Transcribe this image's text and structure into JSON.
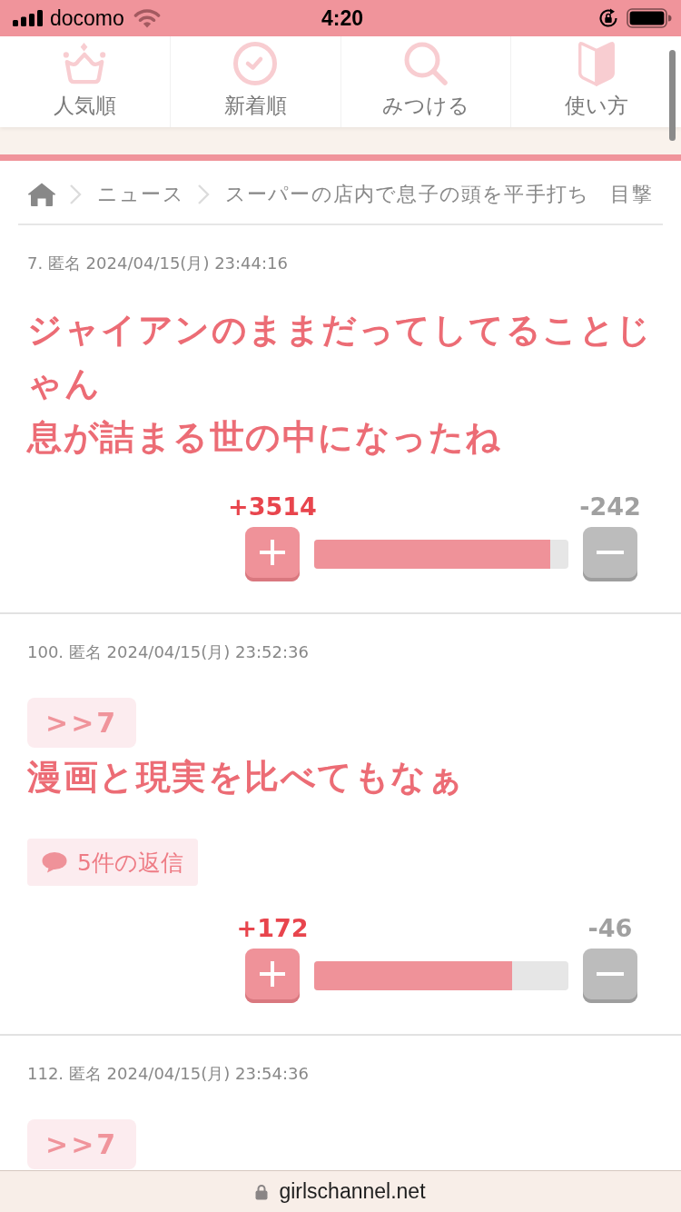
{
  "status_bar": {
    "carrier": "docomo",
    "time": "4:20"
  },
  "nav_tabs": [
    {
      "label": "人気順"
    },
    {
      "label": "新着順"
    },
    {
      "label": "みつける"
    },
    {
      "label": "使い方"
    }
  ],
  "breadcrumb": [
    {
      "label": "ニュース"
    },
    {
      "label": "スーパーの店内で息子の頭を平手打ち　目撃"
    }
  ],
  "comments": [
    {
      "header": "7. 匿名 2024/04/15(月) 23:44:16",
      "body": [
        "ジャイアンのままだってしてることじゃん",
        "息が詰まる世の中になったね"
      ],
      "votes": {
        "plus": "+3514",
        "minus": "-242",
        "level": 0.93
      }
    },
    {
      "header": "100. 匿名 2024/04/15(月) 23:52:36",
      "anchor": ">>7",
      "body": [
        "漫画と現実を比べてもなぁ"
      ],
      "replies": "5件の返信",
      "votes": {
        "plus": "+172",
        "minus": "-46",
        "level": 0.78
      }
    },
    {
      "header": "112. 匿名 2024/04/15(月) 23:54:36",
      "anchor": ">>7"
    }
  ],
  "address_bar": {
    "url": "girlschannel.net"
  }
}
